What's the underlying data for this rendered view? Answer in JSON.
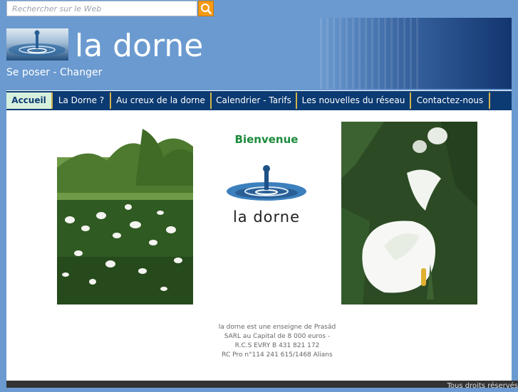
{
  "search": {
    "placeholder": "Rechercher sur le Web",
    "button_icon": "search-icon"
  },
  "header": {
    "title": "la dorne",
    "slogan": "Se poser - Changer",
    "logo_icon": "water-drop-logo"
  },
  "nav": {
    "items": [
      {
        "label": "Accueil",
        "active": true
      },
      {
        "label": "La Dorne ?",
        "active": false
      },
      {
        "label": "Au creux de la dorne",
        "active": false
      },
      {
        "label": "Calendrier - Tarifs",
        "active": false
      },
      {
        "label": "Les nouvelles du réseau",
        "active": false
      },
      {
        "label": "Contactez-nous",
        "active": false
      }
    ]
  },
  "main": {
    "welcome": "Bienvenue",
    "logo_text": "la dorne",
    "left_photo": "calla-lilies-field-photo",
    "right_photo": "white-calla-lily-photo",
    "company_info": [
      "la dorne est une enseigne de Prasâd",
      "SARL au Capital de 8 000 euros -",
      "R.C.S EVRY B 431 821 172",
      "RC Pro n°114 241 615/1468 Alians"
    ]
  },
  "footer": {
    "text": "Tous droits réservés"
  },
  "colors": {
    "page_bg": "#6b9ad0",
    "nav_bg": "#0c3a72",
    "nav_active_bg": "#d7f0dc",
    "welcome_green": "#1a8a3b",
    "search_button": "#f59a12"
  }
}
